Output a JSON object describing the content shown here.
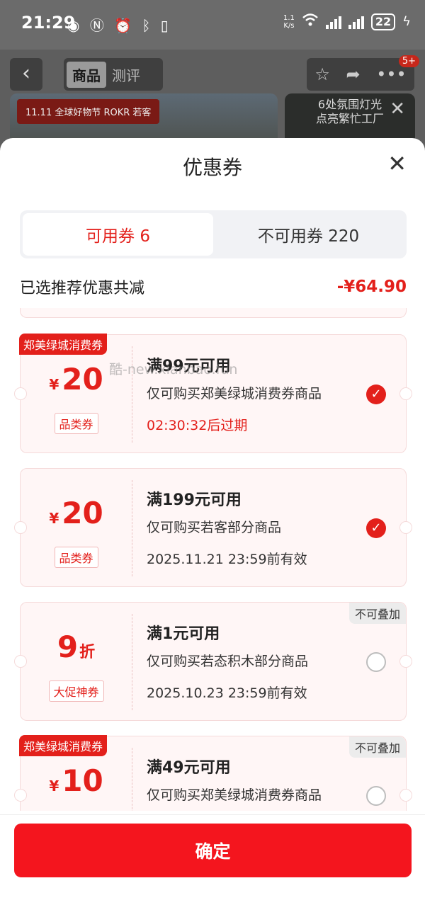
{
  "status_bar": {
    "time": "21:29",
    "net_speed_top": "1.1",
    "net_speed_bottom": "K/s",
    "battery": "22"
  },
  "background_page": {
    "tabs": [
      {
        "label": "商品"
      },
      {
        "label": "测评"
      }
    ],
    "notification_badge": "5+",
    "banner_tag": "11.11 全球好物节  ROKR 若客",
    "banner_right_text_1": "6处氛围灯光",
    "banner_right_text_2": "点亮繁忙工厂"
  },
  "sheet": {
    "title": "优惠券",
    "tabs": [
      {
        "label": "可用券 6",
        "active": true
      },
      {
        "label": "不可用券 220",
        "active": false
      }
    ],
    "summary_label": "已选推荐优惠共减",
    "summary_value": "-¥64.90",
    "watermark": "酷-new.xianbao.fun",
    "confirm_label": "确定"
  },
  "coupons": [
    {
      "top_tag": "郑美绿城消费券",
      "currency": "¥",
      "amount": "20",
      "unit": "",
      "type": "品类券",
      "condition": "满99元可用",
      "description": "仅可购买郑美绿城消费券商品",
      "validity": "02:30:32后过期",
      "validity_red": true,
      "no_stack_tag": "",
      "selected": true
    },
    {
      "top_tag": "",
      "currency": "¥",
      "amount": "20",
      "unit": "",
      "type": "品类券",
      "condition": "满199元可用",
      "description": "仅可购买若客部分商品",
      "validity": "2025.11.21 23:59前有效",
      "validity_red": false,
      "no_stack_tag": "",
      "selected": true
    },
    {
      "top_tag": "",
      "currency": "",
      "amount": "9",
      "unit": "折",
      "type": "大促神券",
      "condition": "满1元可用",
      "description": "仅可购买若态积木部分商品",
      "validity": "2025.10.23 23:59前有效",
      "validity_red": false,
      "no_stack_tag": "不可叠加",
      "selected": false
    },
    {
      "top_tag": "郑美绿城消费券",
      "currency": "¥",
      "amount": "10",
      "unit": "",
      "type": "",
      "condition": "满49元可用",
      "description": "仅可购买郑美绿城消费券商品",
      "validity": "",
      "validity_red": false,
      "no_stack_tag": "不可叠加",
      "selected": false
    }
  ],
  "colors": {
    "accent": "#e3201b",
    "confirm_button": "#f4151e"
  }
}
